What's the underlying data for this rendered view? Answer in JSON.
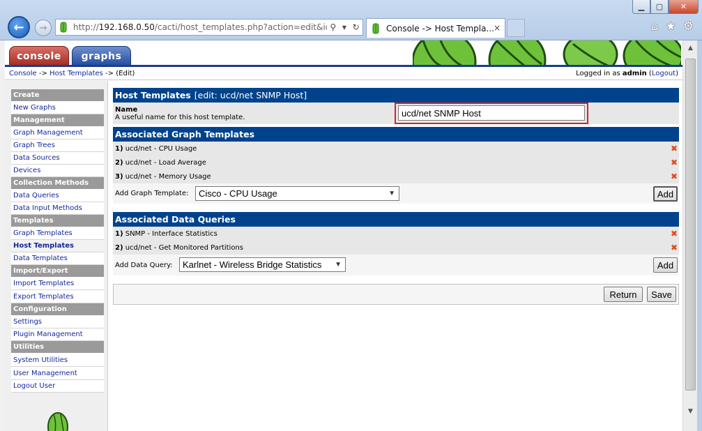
{
  "window": {
    "minimize_icon": "minimize-icon",
    "maximize_icon": "maximize-icon",
    "close_icon": "close-icon"
  },
  "browser": {
    "address": {
      "prefix": "http://",
      "host": "192.168.0.50",
      "path": "/cacti/host_templates.php?action=edit&id",
      "search_icon": "search-icon",
      "dropdown_icon": "chevron-down-icon",
      "refresh_icon": "refresh-icon"
    },
    "tab": {
      "title": "Console -> Host Templa...",
      "close": "×"
    },
    "toolbar_icons": [
      "home-icon",
      "star-icon",
      "gear-icon"
    ]
  },
  "banner": {
    "tabs": [
      {
        "label": "console",
        "color": "#b83a30"
      },
      {
        "label": "graphs",
        "color": "#2b58b0"
      }
    ]
  },
  "breadcrumb": {
    "items": [
      "Console",
      "->",
      "Host Templates",
      "->",
      "(Edit)"
    ],
    "logged_in_prefix": "Logged in as",
    "user": "admin",
    "logout": "Logout"
  },
  "sidebar": {
    "sections": [
      {
        "header": "Create",
        "items": [
          "New Graphs"
        ]
      },
      {
        "header": "Management",
        "items": [
          "Graph Management",
          "Graph Trees",
          "Data Sources",
          "Devices"
        ]
      },
      {
        "header": "Collection Methods",
        "items": [
          "Data Queries",
          "Data Input Methods"
        ]
      },
      {
        "header": "Templates",
        "items": [
          "Graph Templates",
          "Host Templates",
          "Data Templates"
        ]
      },
      {
        "header": "Import/Export",
        "items": [
          "Import Templates",
          "Export Templates"
        ]
      },
      {
        "header": "Configuration",
        "items": [
          "Settings",
          "Plugin Management"
        ]
      },
      {
        "header": "Utilities",
        "items": [
          "System Utilities",
          "User Management",
          "Logout User"
        ]
      }
    ],
    "active_item": "Host Templates"
  },
  "host_template": {
    "title": "Host Templates",
    "subtitle": "[edit: ucd/net SNMP Host]",
    "name_label": "Name",
    "name_desc": "A useful name for this host template.",
    "name_value": "ucd/net SNMP Host"
  },
  "graph_templates": {
    "title": "Associated Graph Templates",
    "items": [
      {
        "num": "1)",
        "label": "ucd/net - CPU Usage"
      },
      {
        "num": "2)",
        "label": "ucd/net - Load Average"
      },
      {
        "num": "3)",
        "label": "ucd/net - Memory Usage"
      }
    ],
    "remove_icon": "x-icon",
    "add_label": "Add Graph Template:",
    "add_selected": "Cisco - CPU Usage",
    "add_button": "Add"
  },
  "data_queries": {
    "title": "Associated Data Queries",
    "items": [
      {
        "num": "1)",
        "label": "SNMP - Interface Statistics"
      },
      {
        "num": "2)",
        "label": "ucd/net - Get Monitored Partitions"
      }
    ],
    "add_label": "Add Data Query:",
    "add_selected": "Karlnet - Wireless Bridge Statistics",
    "add_button": "Add"
  },
  "footer": {
    "return_button": "Return",
    "save_button": "Save"
  },
  "colors": {
    "section_header": "#00438c",
    "link": "#12279b",
    "remove": "#e04a1c",
    "highlight_box": "#d8212a",
    "menu_header": "#9a9a9a"
  }
}
